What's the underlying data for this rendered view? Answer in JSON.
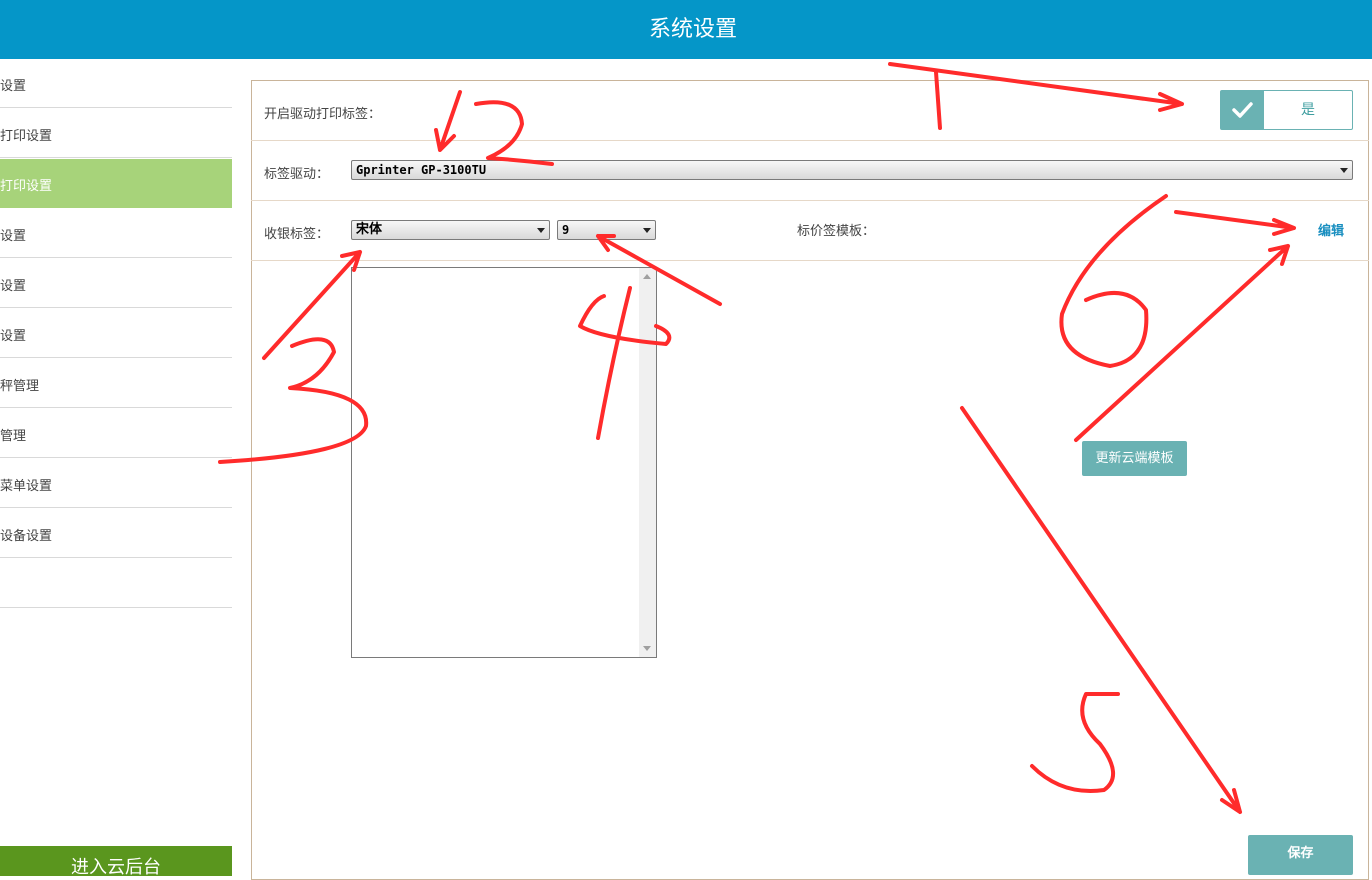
{
  "header": {
    "title": "系统设置"
  },
  "sidebar": {
    "items": [
      {
        "label": "设置"
      },
      {
        "label": "打印设置"
      },
      {
        "label": "打印设置",
        "active": true
      },
      {
        "label": "设置"
      },
      {
        "label": "设置"
      },
      {
        "label": "设置"
      },
      {
        "label": "秤管理"
      },
      {
        "label": "管理"
      },
      {
        "label": "菜单设置"
      },
      {
        "label": "设备设置"
      },
      {
        "label": ""
      }
    ],
    "bottom_button": "进入云后台"
  },
  "settings": {
    "enable_label": "开启驱动打印标签：",
    "toggle_value": "是",
    "driver_label": "标签驱动：",
    "driver_value": "Gprinter GP-3100TU",
    "cashier_label": "收银标签：",
    "font_value": "宋体",
    "size_value": "9",
    "price_template_label": "标价签模板：",
    "edit_link": "编辑",
    "update_button": "更新云端模板",
    "save_button": "保存"
  },
  "annotations": {
    "color": "#ff2b2b",
    "numbers": [
      "1",
      "2",
      "3",
      "4",
      "5",
      "6"
    ]
  }
}
